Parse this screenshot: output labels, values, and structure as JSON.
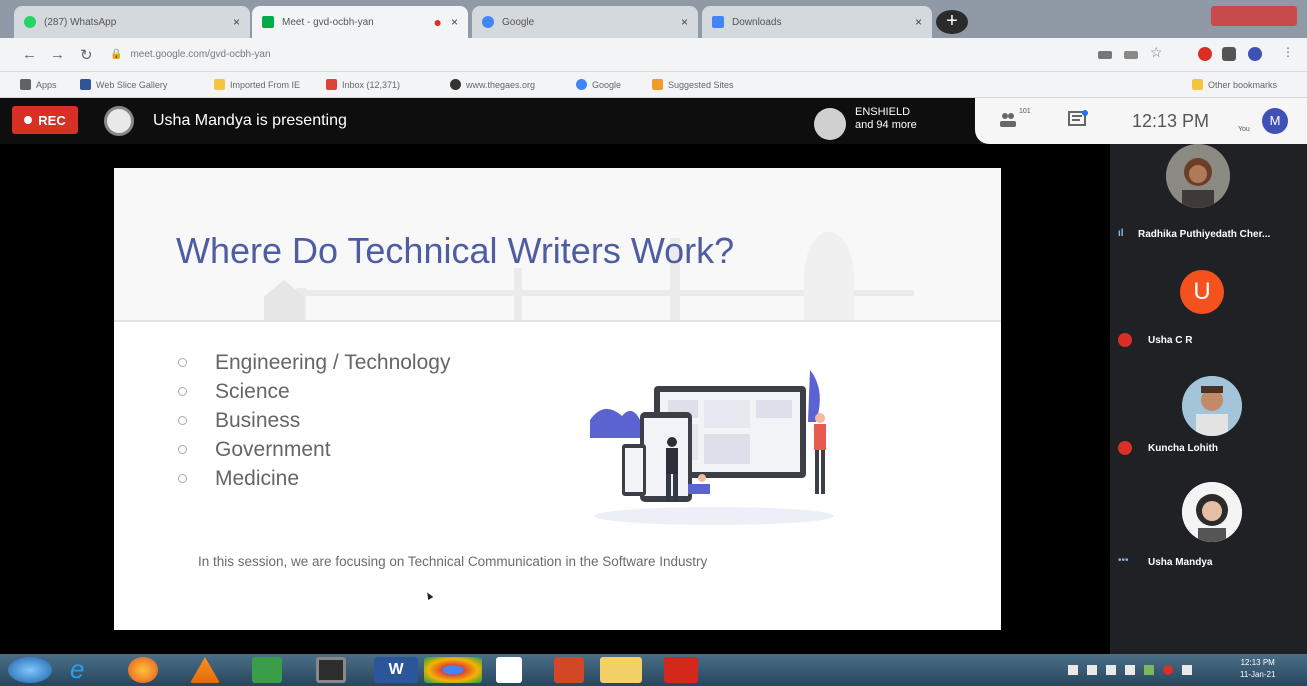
{
  "browser": {
    "tabs": [
      {
        "title": "(287) WhatsApp",
        "favicon_color": "#25d366"
      },
      {
        "title": "Meet - gvd-ocbh-yan",
        "favicon_color": "#00ac47"
      },
      {
        "title": "Google",
        "favicon_color": "#4285f4"
      },
      {
        "title": "Downloads",
        "favicon_color": "#4285f4"
      }
    ],
    "address": "meet.google.com/gvd-ocbh-yan",
    "bookmarks": [
      {
        "label": "Apps",
        "color": "#5f6368"
      },
      {
        "label": "Web Slice Gallery",
        "color": "#2f5597"
      },
      {
        "label": "Imported From IE",
        "color": "#f4c542"
      },
      {
        "label": "Inbox (12,371)",
        "color": "#db4437"
      },
      {
        "label": "www.thegaes.org",
        "color": "#333333"
      },
      {
        "label": "Google",
        "color": "#4285f4"
      },
      {
        "label": "Suggested Sites",
        "color": "#f29a2e"
      }
    ],
    "other_bookmarks": "Other bookmarks"
  },
  "meet": {
    "rec_label": "REC",
    "presenting_text": "Usha Mandya is presenting",
    "pinned": {
      "line1": "ENSHIELD",
      "line2": "and 94 more"
    },
    "participant_count": "101",
    "time": "12:13 PM",
    "you_label": "You",
    "me_initial": "M"
  },
  "slide": {
    "title": "Where Do Technical Writers Work?",
    "bullets": [
      "Engineering / Technology",
      "Science",
      "Business",
      "Government",
      "Medicine"
    ],
    "footer": "In this session, we are focusing on Technical Communication in the Software Industry"
  },
  "participants": [
    {
      "name": "Radhika Puthiyedath Cher...",
      "indicator": "speaking"
    },
    {
      "name": "Usha C R",
      "initial": "U",
      "indicator": "muted"
    },
    {
      "name": "Kuncha Lohith",
      "indicator": "muted"
    },
    {
      "name": "Usha Mandya",
      "indicator": "more"
    }
  ],
  "taskbar": {
    "time": "12:13 PM",
    "date": "11-Jan-21"
  },
  "colors": {
    "rec_red": "#d93025",
    "slide_title": "#4e5da1",
    "usha_orange": "#f4511e",
    "me_avatar": "#3f51b5"
  }
}
